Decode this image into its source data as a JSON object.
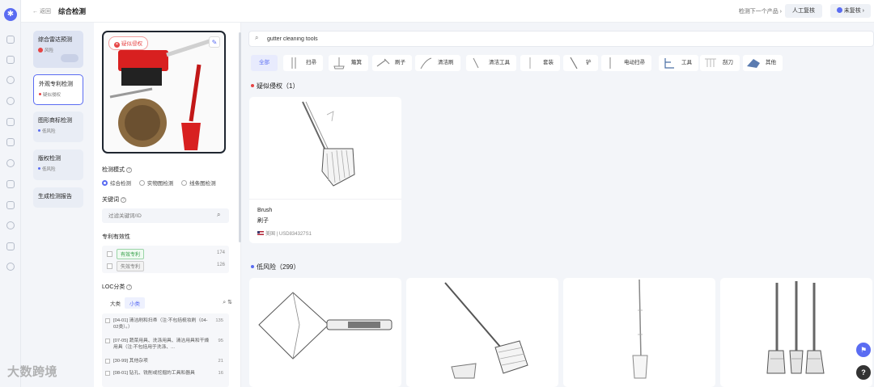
{
  "header": {
    "back_label": "← 返回",
    "page_title": "综合检测",
    "next_product": "检测下一个产品 ›",
    "manual_review": "人工复核",
    "review_status": "未复核 ›"
  },
  "steps": [
    {
      "name": "综合雷达预测",
      "sub": "风险",
      "toggle": "0 0"
    },
    {
      "name": "外观专利检测",
      "sub": "疑似侵权"
    },
    {
      "name": "图形商标检测",
      "sub": "低风险"
    },
    {
      "name": "版权检测",
      "sub": "低风险"
    },
    {
      "name": "生成检测报告",
      "sub": ""
    }
  ],
  "filters": {
    "product_badge": "疑似侵权",
    "detect_mode_label": "检测模式",
    "modes": [
      "综合检测",
      "实物图检测",
      "线条图检测"
    ],
    "selected_mode": "综合检测",
    "keyword_label": "关键词",
    "keyword_placeholder": "过滤关键词/ID",
    "validity_label": "专利有效性",
    "validity": [
      {
        "label": "有效专利",
        "count": "174"
      },
      {
        "label": "失效专利",
        "count": "126"
      }
    ],
    "loc_label": "LOC分类",
    "loc_tabs": [
      "大类",
      "小类"
    ],
    "loc_selected_tab": "小类",
    "loc_items": [
      {
        "text": "[04-01] 清洁刷和扫帚（注:不包括梳妆刷（04-02类）。）",
        "count": "135"
      },
      {
        "text": "[07-05] 蔬菜用具、洗涤用具、清洁用具和干燥用具（注:不包括用于洗涤、...",
        "count": "95"
      },
      {
        "text": "[30-99] 其他杂项",
        "count": "21"
      },
      {
        "text": "[08-01] 钻孔、铣削或挖掘的工具和器具",
        "count": "16"
      }
    ]
  },
  "search": {
    "value": "gutter cleaning tools"
  },
  "categories": [
    {
      "label": "全部",
      "active": true
    },
    {
      "label": "扫帚"
    },
    {
      "label": "簸箕"
    },
    {
      "label": "刷子"
    },
    {
      "label": "清洁刷"
    },
    {
      "label": "清洁工具"
    },
    {
      "label": "套装"
    },
    {
      "label": "铲"
    },
    {
      "label": "电动扫帚"
    },
    {
      "label": "工具"
    },
    {
      "label": "刮刀"
    },
    {
      "label": "其他"
    }
  ],
  "groups": [
    {
      "title": "疑似侵权（1）",
      "color": "#e64545"
    },
    {
      "title": "低风险（299）",
      "color": "#5a6cf2"
    }
  ],
  "suspected_item": {
    "name_en": "Brush",
    "name_cn": "刷子",
    "country": "美国",
    "patent_id": "USD834327S1"
  },
  "watermark": "大数跨境",
  "fab": {
    "flag_icon": "flag-icon",
    "help": "?"
  }
}
